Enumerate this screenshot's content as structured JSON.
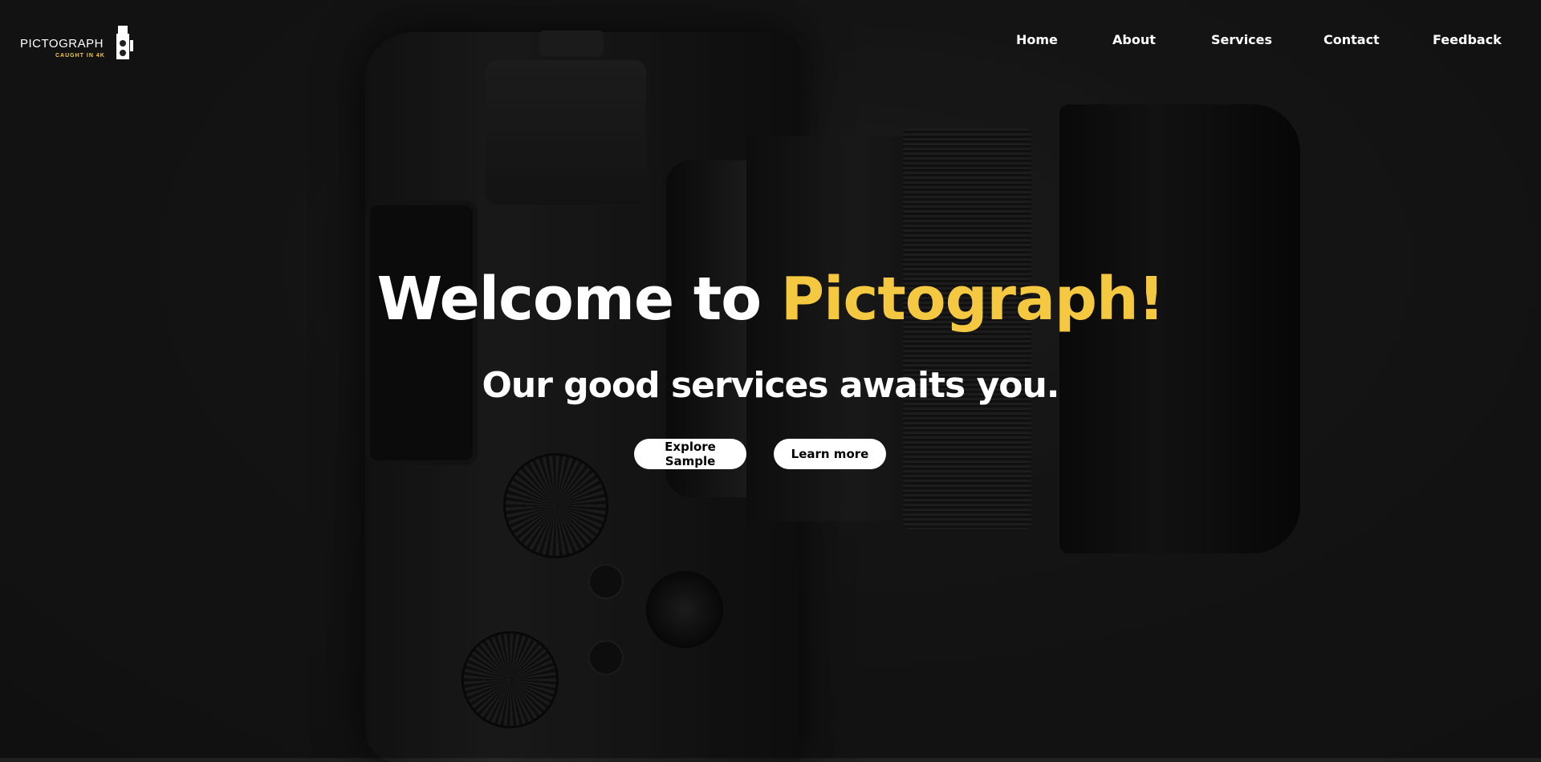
{
  "logo": {
    "name": "PICTOGRAPH",
    "tagline": "CAUGHT IN 4K",
    "icon": "camera-icon"
  },
  "nav": {
    "items": [
      {
        "label": "Home"
      },
      {
        "label": "About"
      },
      {
        "label": "Services"
      },
      {
        "label": "Contact"
      },
      {
        "label": "Feedback"
      }
    ]
  },
  "hero": {
    "headline_prefix": "Welcome to ",
    "headline_brand": "Pictograph!",
    "subheadline": "Our good services awaits you.",
    "background": "camera-photo",
    "buttons": {
      "explore": "Explore Sample",
      "learn": "Learn more"
    }
  },
  "colors": {
    "accent": "#f5c842",
    "background": "#202020",
    "text": "#ffffff"
  }
}
